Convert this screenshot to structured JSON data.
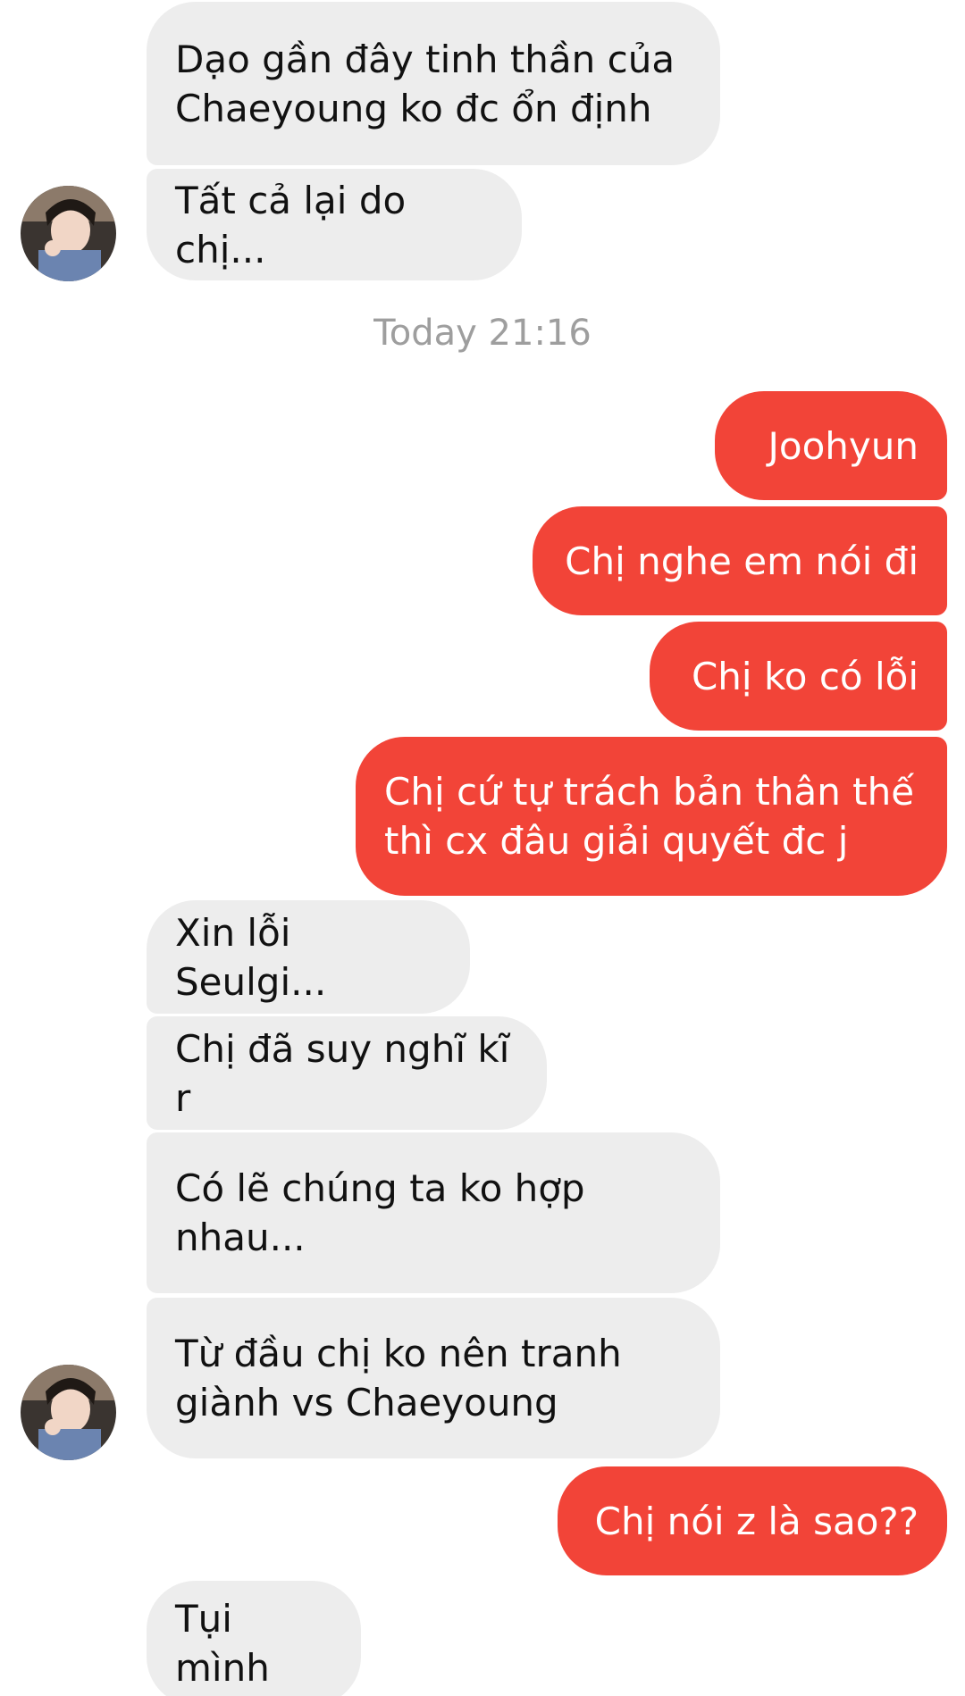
{
  "thread": {
    "timestamp": "Today 21:16",
    "messages": [
      {
        "side": "incoming",
        "text": "Dạo gần đây tinh thần của\nChaeyoung ko đc ổn định"
      },
      {
        "side": "incoming",
        "text": "Tất cả lại do chị..."
      },
      {
        "side": "outgoing",
        "text": "Joohyun"
      },
      {
        "side": "outgoing",
        "text": "Chị nghe em nói đi"
      },
      {
        "side": "outgoing",
        "text": "Chị ko có lỗi"
      },
      {
        "side": "outgoing",
        "text": "Chị cứ tự trách bản thân thế\nthì cx đâu giải quyết đc j"
      },
      {
        "side": "incoming",
        "text": "Xin lỗi Seulgi..."
      },
      {
        "side": "incoming",
        "text": "Chị đã suy nghĩ kĩ r"
      },
      {
        "side": "incoming",
        "text": "Có lẽ chúng ta ko hợp\nnhau..."
      },
      {
        "side": "incoming",
        "text": "Từ đầu chị ko nên tranh\ngiành vs Chaeyoung"
      },
      {
        "side": "outgoing",
        "text": "Chị nói z là sao??"
      },
      {
        "side": "incoming",
        "text": "Tụi mình"
      }
    ]
  },
  "colors": {
    "incoming_bubble": "#ededed",
    "outgoing_bubble": "#f24438",
    "timestamp_text": "#9e9e9e"
  },
  "icons": {
    "avatar": "contact-avatar-photo"
  }
}
